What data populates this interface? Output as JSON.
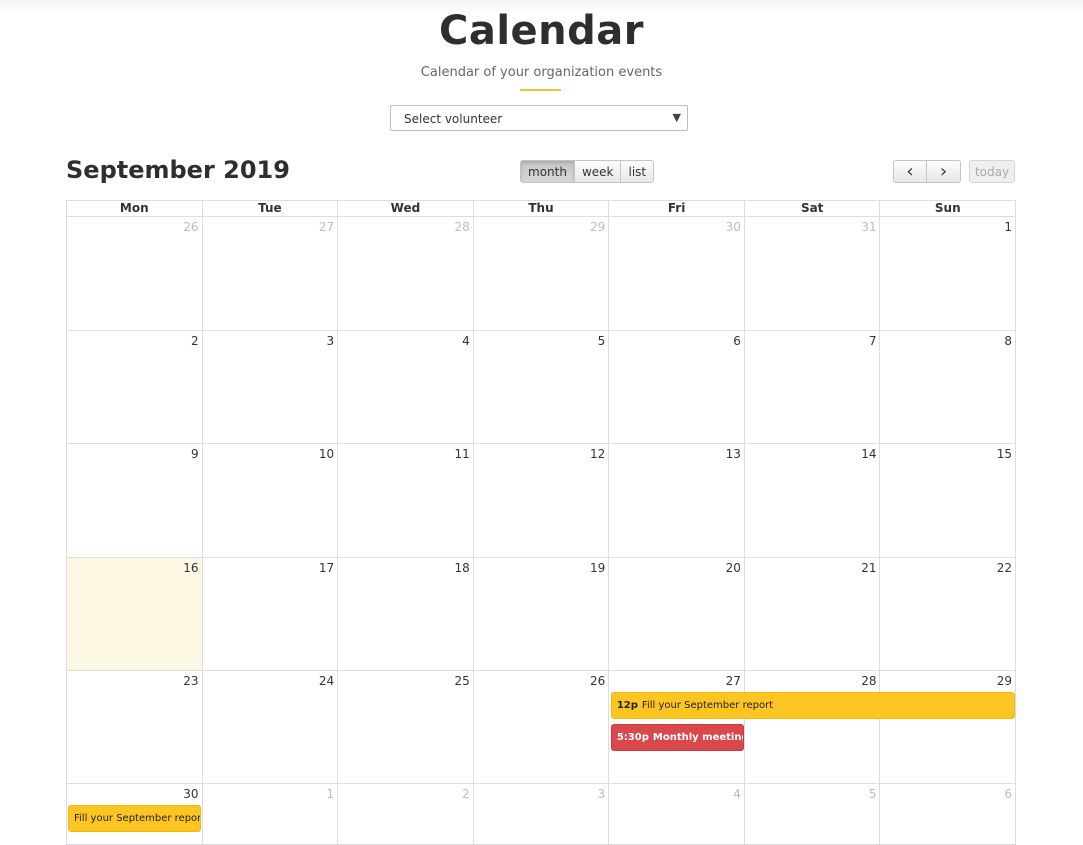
{
  "header": {
    "title": "Calendar",
    "subtitle": "Calendar of your organization events"
  },
  "volunteer_select": {
    "value": "Select volunteer"
  },
  "toolbar": {
    "month_title": "September 2019",
    "views": [
      "month",
      "week",
      "list"
    ],
    "active_view": "month",
    "prev_icon": "‹",
    "next_icon": "›",
    "today_label": "today"
  },
  "calendar": {
    "weekdays": [
      "Mon",
      "Tue",
      "Wed",
      "Thu",
      "Fri",
      "Sat",
      "Sun"
    ],
    "today": 16,
    "weeks": [
      [
        {
          "d": "26",
          "other": true
        },
        {
          "d": "27",
          "other": true
        },
        {
          "d": "28",
          "other": true
        },
        {
          "d": "29",
          "other": true
        },
        {
          "d": "30",
          "other": true
        },
        {
          "d": "31",
          "other": true
        },
        {
          "d": "1"
        }
      ],
      [
        {
          "d": "2"
        },
        {
          "d": "3"
        },
        {
          "d": "4"
        },
        {
          "d": "5"
        },
        {
          "d": "6"
        },
        {
          "d": "7"
        },
        {
          "d": "8"
        }
      ],
      [
        {
          "d": "9"
        },
        {
          "d": "10"
        },
        {
          "d": "11"
        },
        {
          "d": "12"
        },
        {
          "d": "13"
        },
        {
          "d": "14"
        },
        {
          "d": "15"
        }
      ],
      [
        {
          "d": "16"
        },
        {
          "d": "17"
        },
        {
          "d": "18"
        },
        {
          "d": "19"
        },
        {
          "d": "20"
        },
        {
          "d": "21"
        },
        {
          "d": "22"
        }
      ],
      [
        {
          "d": "23"
        },
        {
          "d": "24"
        },
        {
          "d": "25"
        },
        {
          "d": "26"
        },
        {
          "d": "27"
        },
        {
          "d": "28"
        },
        {
          "d": "29"
        }
      ],
      [
        {
          "d": "30"
        },
        {
          "d": "1",
          "other": true
        },
        {
          "d": "2",
          "other": true
        },
        {
          "d": "3",
          "other": true
        },
        {
          "d": "4",
          "other": true
        },
        {
          "d": "5",
          "other": true
        },
        {
          "d": "6",
          "other": true
        }
      ]
    ],
    "events": [
      {
        "week": 4,
        "startCol": 4,
        "span": 3,
        "lane": 0,
        "time": "12p",
        "title": "Fill your September report",
        "color": "yellow"
      },
      {
        "week": 4,
        "startCol": 4,
        "span": 1,
        "lane": 1,
        "time": "5:30p",
        "title": "Monthly meeting - A",
        "color": "red"
      },
      {
        "week": 5,
        "startCol": 0,
        "span": 1,
        "lane": 0,
        "time": "",
        "title": "Fill your September report",
        "color": "yellow"
      }
    ]
  },
  "colors": {
    "accent": "#f1c232",
    "event_yellow": "#fdc521",
    "event_red": "#d9484a",
    "today_bg": "#fcf8e3"
  }
}
